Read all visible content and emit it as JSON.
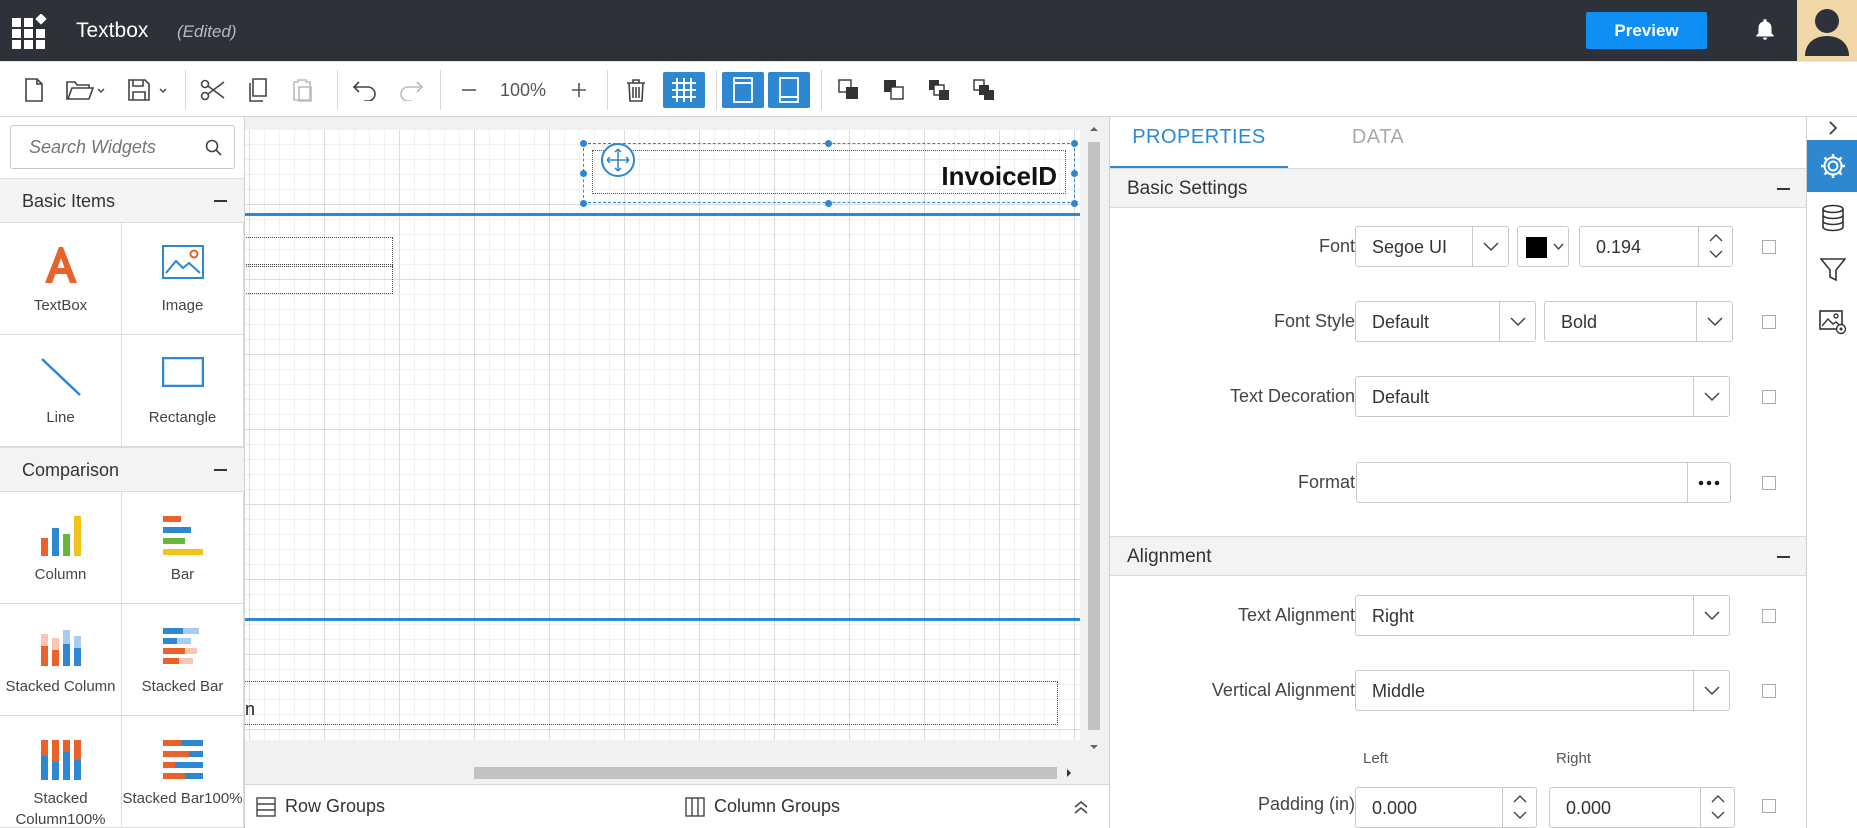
{
  "header": {
    "title": "Textbox",
    "status": "(Edited)",
    "preview_label": "Preview"
  },
  "toolbar": {
    "zoom": "100%"
  },
  "search": {
    "placeholder": "Search Widgets"
  },
  "widgets": {
    "categories": [
      {
        "label": "Basic Items",
        "items": [
          {
            "label": "TextBox",
            "icon": "textbox-icon"
          },
          {
            "label": "Image",
            "icon": "image-icon"
          },
          {
            "label": "Line",
            "icon": "line-icon"
          },
          {
            "label": "Rectangle",
            "icon": "rectangle-icon"
          }
        ]
      },
      {
        "label": "Comparison",
        "items": [
          {
            "label": "Column",
            "icon": "column-chart-icon"
          },
          {
            "label": "Bar",
            "icon": "bar-chart-icon"
          },
          {
            "label": "Stacked Column",
            "icon": "stacked-column-icon"
          },
          {
            "label": "Stacked Bar",
            "icon": "stacked-bar-icon"
          },
          {
            "label": "Stacked Column100%",
            "icon": "stacked-column100-icon"
          },
          {
            "label": "Stacked Bar100%",
            "icon": "stacked-bar100-icon"
          }
        ]
      }
    ]
  },
  "canvas": {
    "selected_text": "InvoiceID",
    "partial_text": "n"
  },
  "groups": {
    "row": "Row Groups",
    "column": "Column Groups"
  },
  "properties": {
    "tabs": [
      "PROPERTIES",
      "DATA"
    ],
    "basic_settings": {
      "title": "Basic Settings",
      "font_label": "Font",
      "font_value": "Segoe UI",
      "font_color": "#000000",
      "font_size": "0.194",
      "font_style_label": "Font Style",
      "font_style_value": "Default",
      "font_weight_value": "Bold",
      "text_decoration_label": "Text Decoration",
      "text_decoration_value": "Default",
      "format_label": "Format",
      "format_value": ""
    },
    "alignment": {
      "title": "Alignment",
      "text_alignment_label": "Text Alignment",
      "text_alignment_value": "Right",
      "vertical_alignment_label": "Vertical Alignment",
      "vertical_alignment_value": "Middle",
      "padding_label": "Padding (in)",
      "left_label": "Left",
      "right_label": "Right",
      "padding_left": "0.000",
      "padding_right": "0.000"
    }
  },
  "colors": {
    "accent": "#2d87d1",
    "preview": "#0f8ff5",
    "header_bg": "#2d313a"
  }
}
